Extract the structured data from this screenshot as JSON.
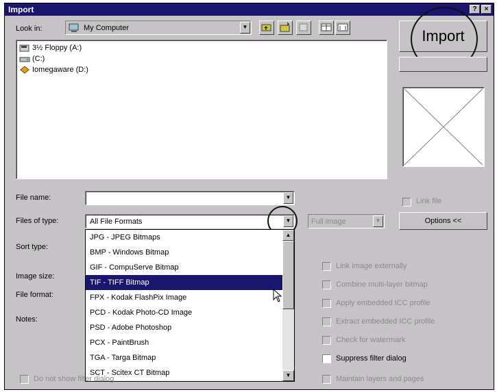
{
  "window": {
    "title": "Import",
    "help_icon": "?",
    "close_icon": "×"
  },
  "look_in": {
    "label": "Look in:",
    "value": "My Computer"
  },
  "file_list": [
    {
      "name": "3½ Floppy (A:)",
      "icon": "floppy-drive-icon"
    },
    {
      "name": "(C:)",
      "icon": "hard-drive-icon"
    },
    {
      "name": "Iomegaware (D:)",
      "icon": "cd-drive-icon"
    }
  ],
  "buttons": {
    "import": "Import",
    "options": "Options <<"
  },
  "file_name": {
    "label": "File name:",
    "value": ""
  },
  "files_of_type": {
    "label": "Files of type:",
    "value": "All File Formats",
    "options": [
      "JPG - JPEG Bitmaps",
      "BMP - Windows Bitmap",
      "GIF - CompuServe Bitmap",
      "TIF - TIFF Bitmap",
      "FPX - Kodak FlashPix Image",
      "PCD - Kodak Photo-CD Image",
      "PSD - Adobe Photoshop",
      "PCX - PaintBrush",
      "TGA - Targa Bitmap",
      "SCT - Scitex CT Bitmap"
    ],
    "selected_index": 3
  },
  "full_image": {
    "value": "Full image"
  },
  "labels": {
    "sort_type": "Sort type:",
    "image_size": "Image size:",
    "file_format": "File format:",
    "notes": "Notes:"
  },
  "checkboxes": {
    "link": "Link file",
    "options": [
      {
        "label": "Link image externally",
        "checked": false,
        "enabled": false
      },
      {
        "label": "Combine multi-layer bitmap",
        "checked": false,
        "enabled": false
      },
      {
        "label": "Apply embedded ICC profile",
        "checked": false,
        "enabled": false
      },
      {
        "label": "Extract embedded ICC profile",
        "checked": false,
        "enabled": false
      },
      {
        "label": "Check for watermark",
        "checked": false,
        "enabled": false
      },
      {
        "label": "Suppress filter dialog",
        "checked": false,
        "enabled": true
      },
      {
        "label": "Maintain layers and pages",
        "checked": false,
        "enabled": false
      }
    ],
    "bottom_left": "Do not show filter dialog"
  }
}
